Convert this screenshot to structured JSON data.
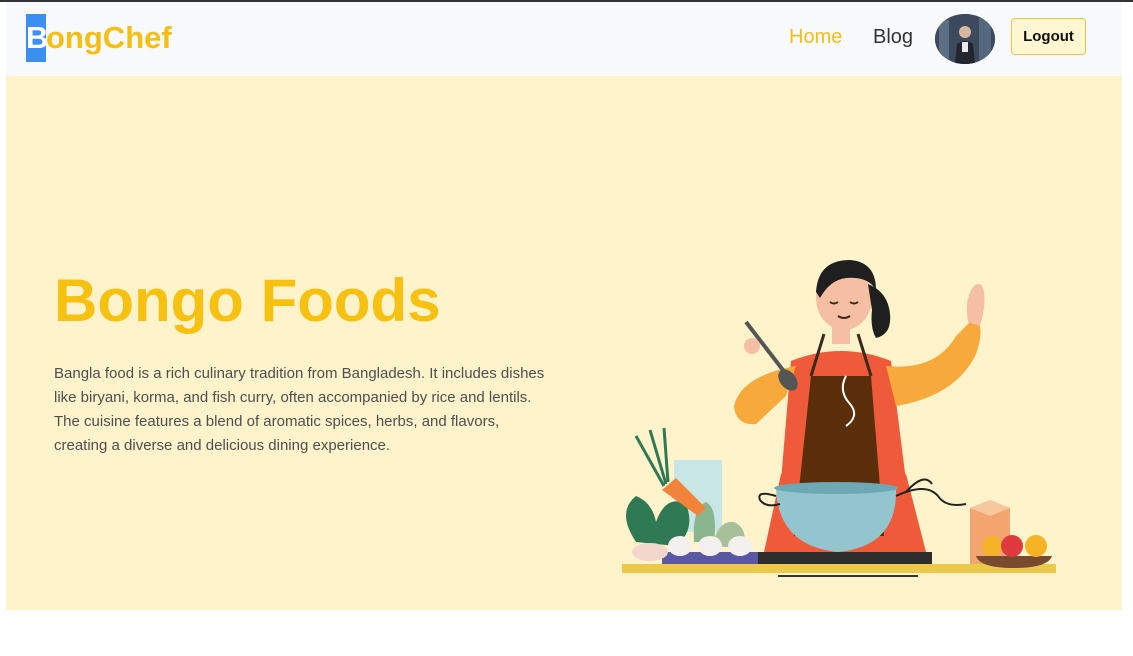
{
  "navbar": {
    "logo_first_letter": "B",
    "logo_rest": "ongChef",
    "links": [
      {
        "label": "Home",
        "active": true
      },
      {
        "label": "Blog",
        "active": false
      }
    ],
    "logout_label": "Logout"
  },
  "hero": {
    "title": "Bongo Foods",
    "description": "Bangla food is a rich culinary tradition from Bangladesh. It includes dishes like biryani, korma, and fish curry, often accompanied by rice and lentils. The cuisine features a blend of aromatic spices, herbs, and flavors, creating a diverse and delicious dining experience."
  },
  "colors": {
    "brand_yellow": "#f6bd12",
    "logo_highlight": "#3b8ff3",
    "hero_background": "#fff3cc"
  }
}
